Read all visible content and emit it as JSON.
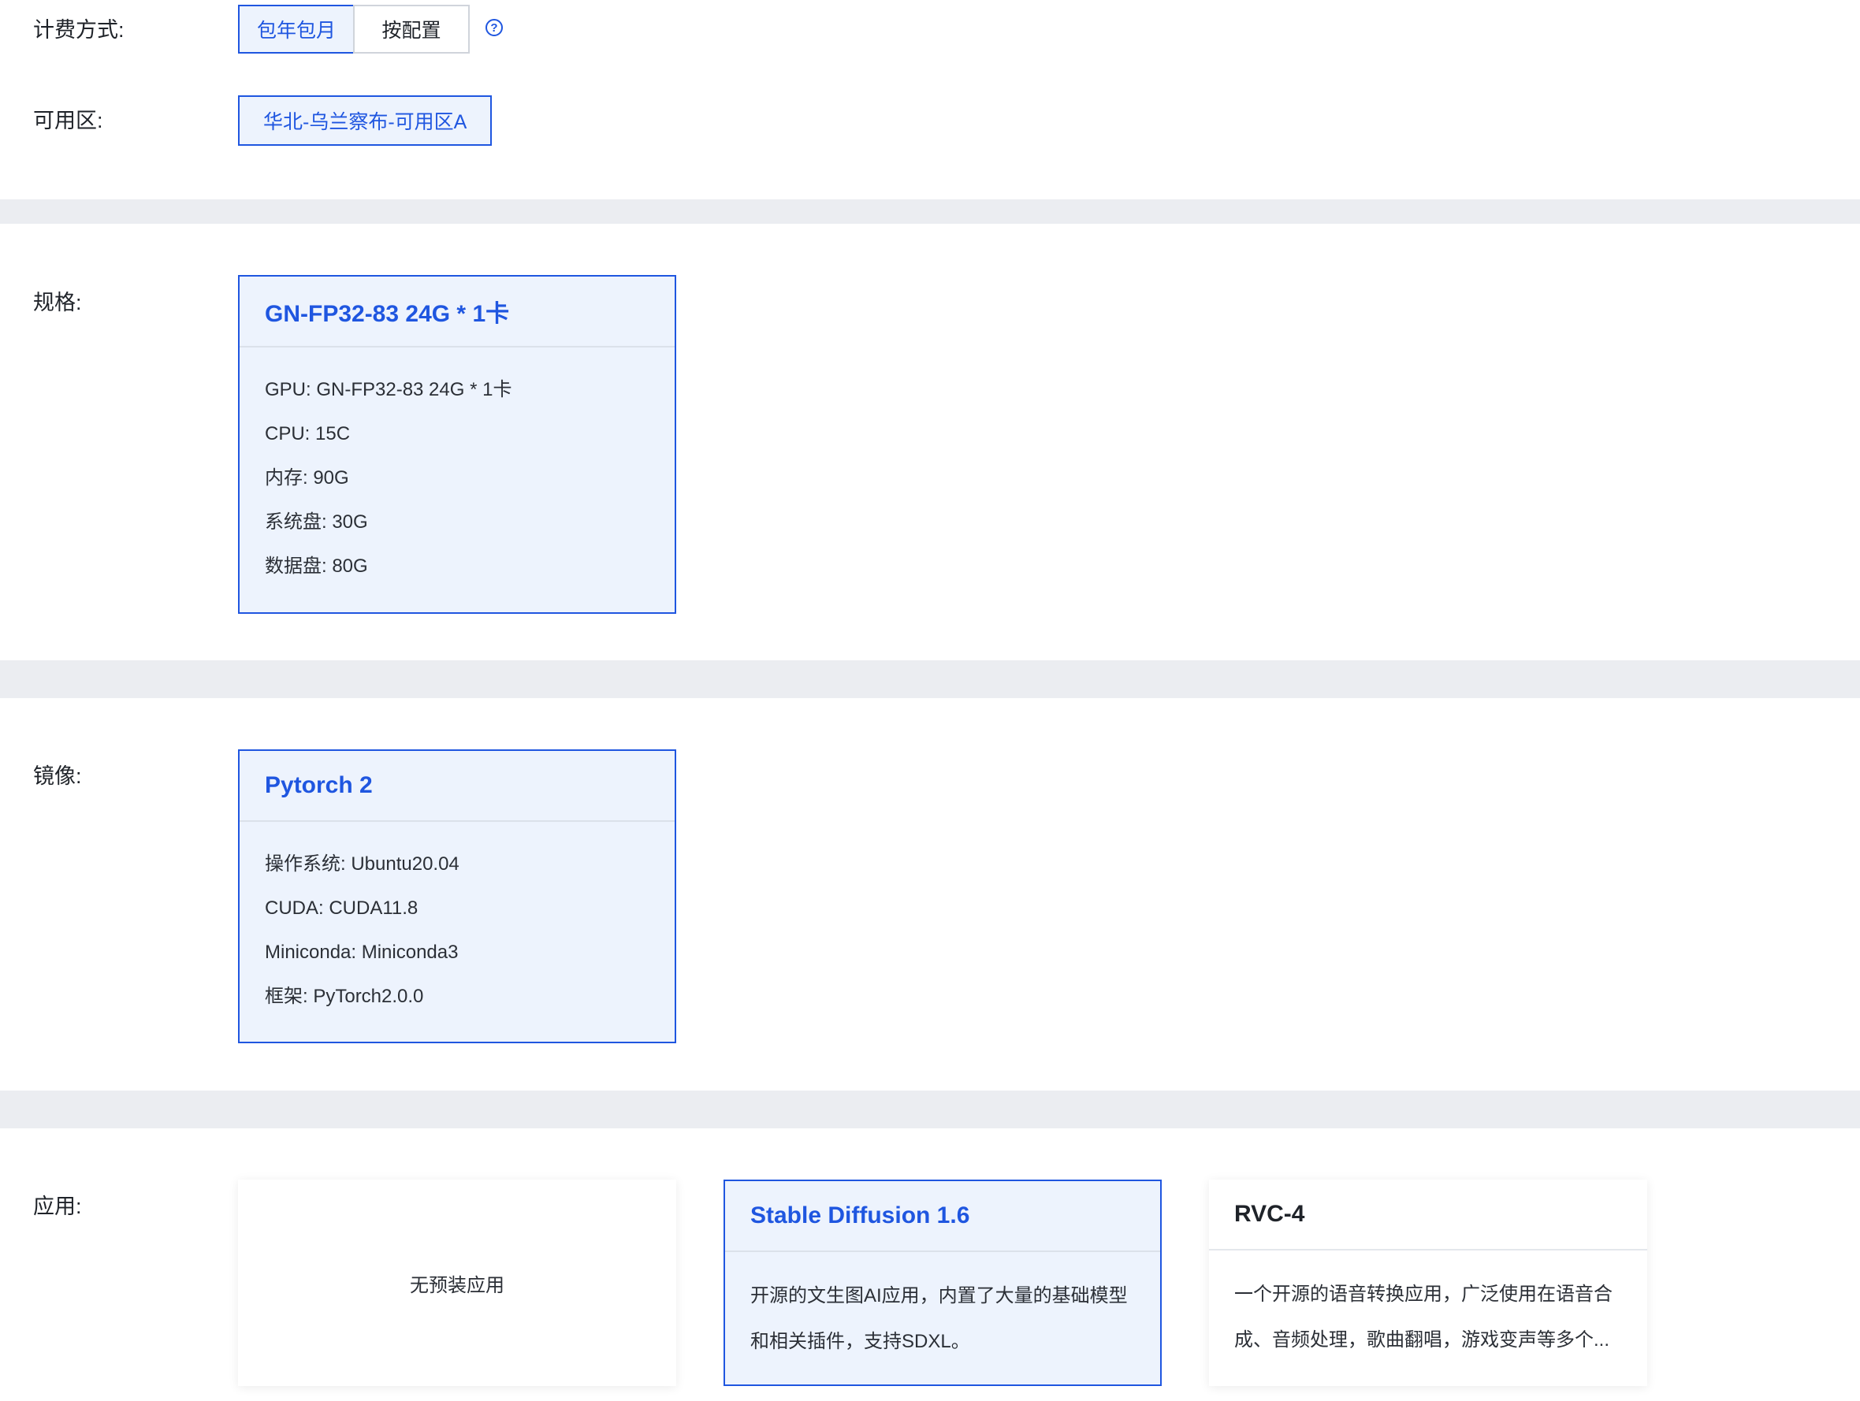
{
  "billing": {
    "label": "计费方式:",
    "options": [
      {
        "label": "包年包月",
        "selected": true
      },
      {
        "label": "按配置",
        "selected": false
      }
    ],
    "help_glyph": "?"
  },
  "zone": {
    "label": "可用区:",
    "selected": "华北-乌兰察布-可用区A"
  },
  "spec": {
    "label": "规格:",
    "card": {
      "title": "GN-FP32-83 24G * 1卡",
      "rows": [
        "GPU: GN-FP32-83 24G * 1卡",
        "CPU: 15C",
        "内存: 90G",
        "系统盘: 30G",
        "数据盘: 80G"
      ]
    }
  },
  "image": {
    "label": "镜像:",
    "card": {
      "title": "Pytorch 2",
      "rows": [
        "操作系统: Ubuntu20.04",
        "CUDA: CUDA11.8",
        "Miniconda: Miniconda3",
        "框架: PyTorch2.0.0"
      ]
    }
  },
  "apps": {
    "label": "应用:",
    "none_label": "无预装应用",
    "items": [
      {
        "title": "Stable Diffusion 1.6",
        "selected": true,
        "desc_lines": [
          "开源的文生图AI应用，内置了大量的基础模型",
          "和相关插件，支持SDXL。"
        ]
      },
      {
        "title": "RVC-4",
        "selected": false,
        "desc_lines": [
          "一个开源的语音转换应用，广泛使用在语音合",
          "成、音频处理，歌曲翻唱，游戏变声等多个..."
        ]
      }
    ]
  },
  "colors": {
    "accent": "#1f56e0",
    "selected_bg": "#edf3fd",
    "section_band": "#ebedf1"
  }
}
